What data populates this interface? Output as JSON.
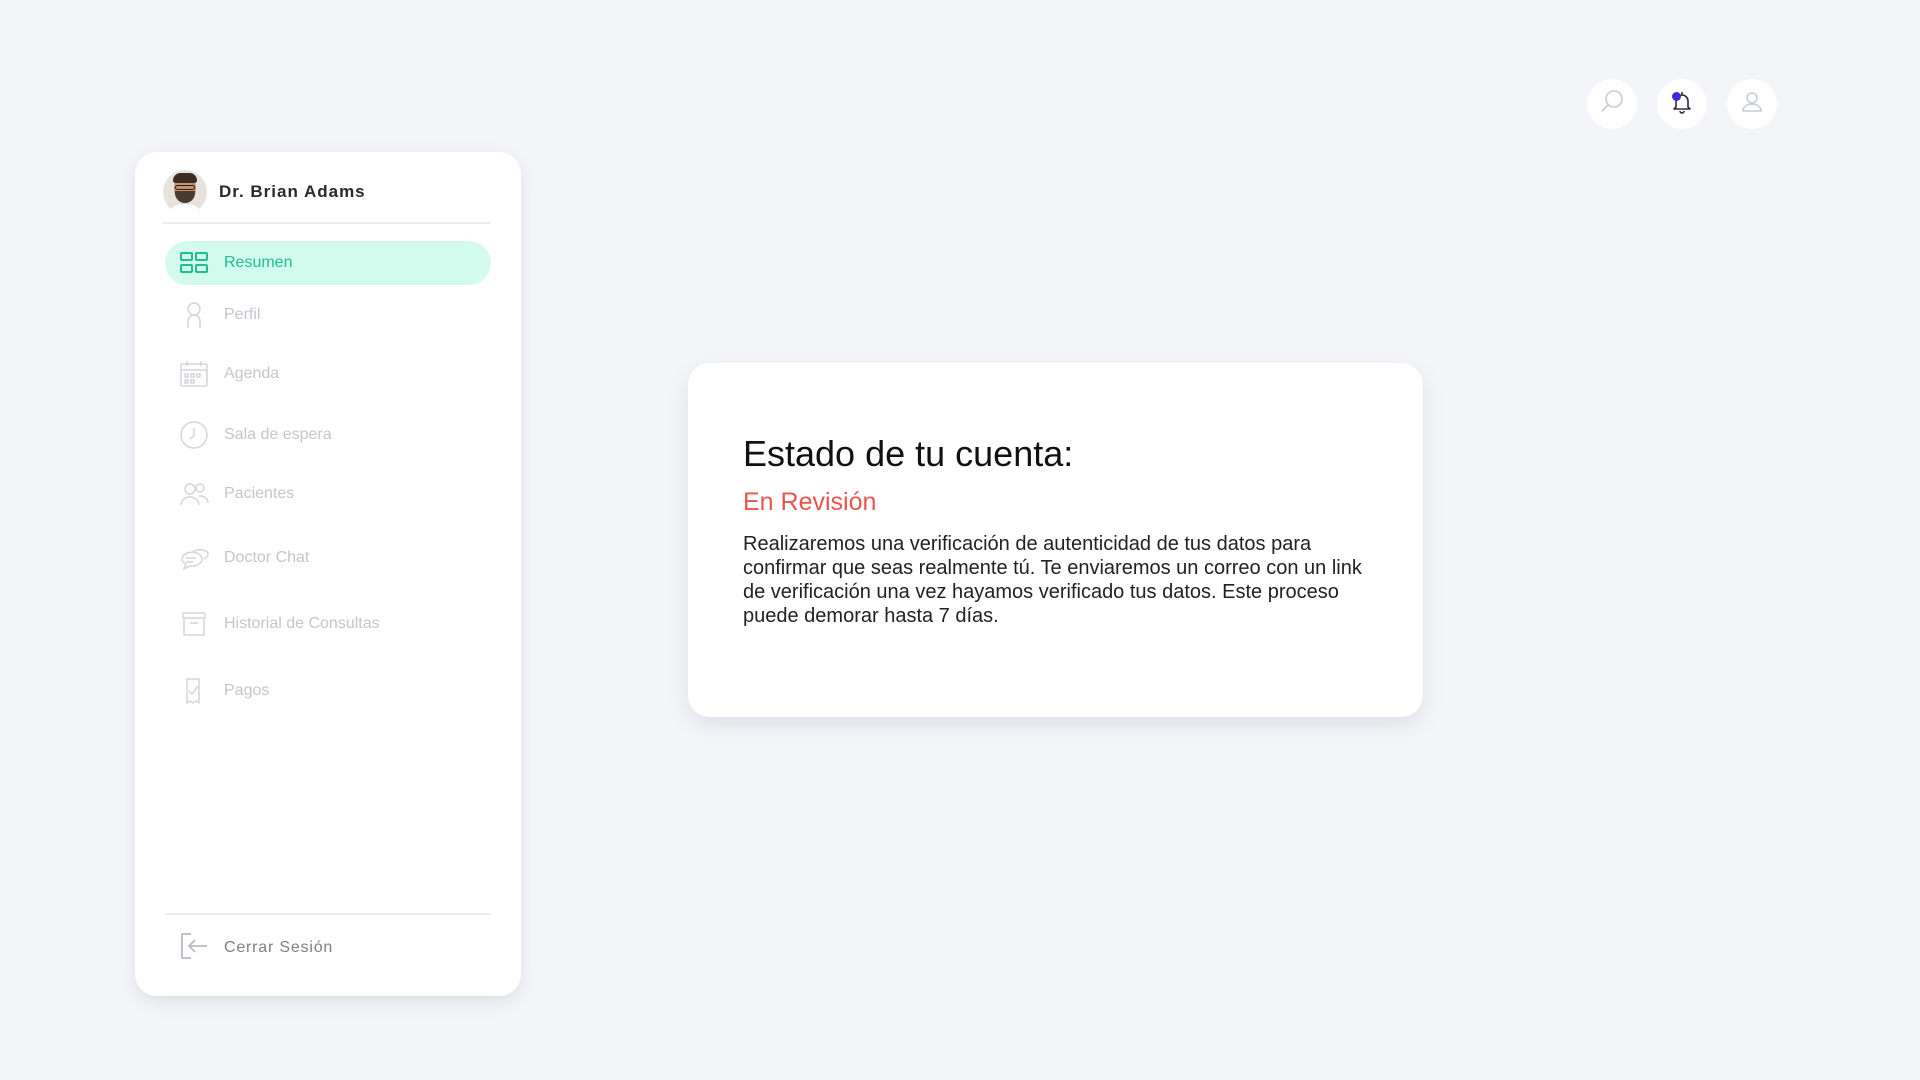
{
  "user": {
    "name": "Dr. Brian Adams"
  },
  "sidebar": {
    "items": [
      {
        "label": "Resumen",
        "icon": "dashboard-grid-icon",
        "active": true
      },
      {
        "label": "Perfil",
        "icon": "user-icon",
        "active": false
      },
      {
        "label": "Agenda",
        "icon": "calendar-icon",
        "active": false
      },
      {
        "label": "Sala de espera",
        "icon": "clock-icon",
        "active": false
      },
      {
        "label": "Pacientes",
        "icon": "users-icon",
        "active": false
      },
      {
        "label": "Doctor Chat",
        "icon": "chat-bubbles-icon",
        "active": false
      },
      {
        "label": "Historial de Consultas",
        "icon": "archive-icon",
        "active": false
      },
      {
        "label": "Pagos",
        "icon": "receipt-check-icon",
        "active": false
      }
    ],
    "logout_label": "Cerrar Sesión"
  },
  "header": {
    "icons": [
      "search-icon",
      "bell-icon",
      "user-icon"
    ]
  },
  "status_card": {
    "title": "Estado de tu cuenta:",
    "status": "En Revisión",
    "body": "Realizaremos una verificación de autenticidad de tus datos para confirmar que seas realmente tú. Te enviaremos un correo con un link de verificación una vez hayamos verificado tus datos. Este proceso puede demorar hasta 7 días."
  },
  "colors": {
    "background": "#f4f5f9",
    "accent": "#1dbf8d",
    "accent_bg": "#d2fbee",
    "status": "#e8564d",
    "notification": "#3b2bd6",
    "inactive": "#c2c6cf"
  }
}
